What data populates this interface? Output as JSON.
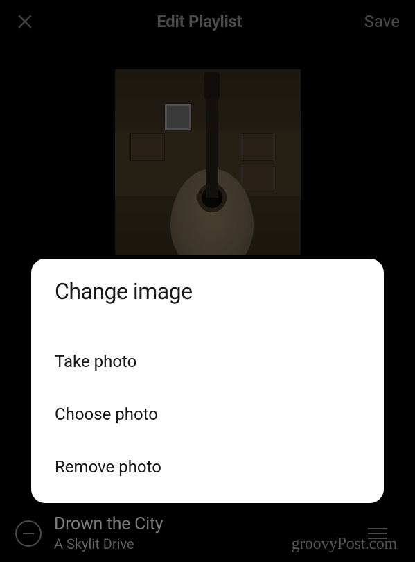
{
  "header": {
    "title": "Edit Playlist",
    "save_label": "Save"
  },
  "sheet": {
    "title": "Change image",
    "options": {
      "take": "Take photo",
      "choose": "Choose photo",
      "remove": "Remove photo"
    }
  },
  "track": {
    "title": "Drown the City",
    "artist": "A Skylit Drive"
  },
  "watermark": "groovyPost.com"
}
